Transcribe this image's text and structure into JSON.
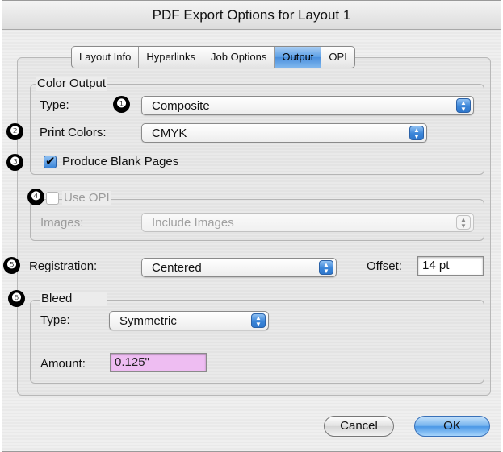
{
  "window": {
    "title": "PDF Export Options for Layout 1"
  },
  "tabs": [
    "Layout Info",
    "Hyperlinks",
    "Job Options",
    "Output",
    "OPI"
  ],
  "active_tab": "Output",
  "color_output": {
    "legend": "Color Output",
    "type_label": "Type:",
    "type_value": "Composite",
    "print_colors_label": "Print Colors:",
    "print_colors_value": "CMYK",
    "blank_pages_label": "Produce Blank Pages",
    "blank_pages_checked": true
  },
  "opi": {
    "legend": "Use OPI",
    "checked": false,
    "images_label": "Images:",
    "images_value": "Include Images"
  },
  "registration": {
    "label": "Registration:",
    "value": "Centered",
    "offset_label": "Offset:",
    "offset_value": "14 pt"
  },
  "bleed": {
    "legend": "Bleed",
    "type_label": "Type:",
    "type_value": "Symmetric",
    "amount_label": "Amount:",
    "amount_value": "0.125\""
  },
  "markers": [
    "❶",
    "❷",
    "❸",
    "❹",
    "❺",
    "❻"
  ],
  "buttons": {
    "cancel": "Cancel",
    "ok": "OK"
  },
  "colors": {
    "accent": "#4a97e6",
    "highlight_field": "#eebdf2"
  }
}
